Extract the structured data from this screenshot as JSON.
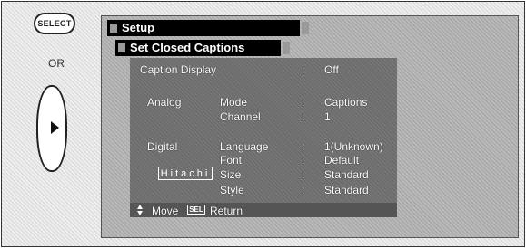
{
  "remote": {
    "select_label": "SELECT",
    "or_label": "OR"
  },
  "menu": {
    "tab_setup": "Setup",
    "tab_closed_captions": "Set Closed Captions",
    "caption_display": {
      "label": "Caption Display",
      "sep": ":",
      "value": "Off"
    },
    "analog": {
      "heading": "Analog",
      "mode": {
        "label": "Mode",
        "sep": ":",
        "value": "Captions"
      },
      "channel": {
        "label": "Channel",
        "sep": ":",
        "value": "1"
      }
    },
    "digital": {
      "heading": "Digital",
      "language": {
        "label": "Language",
        "sep": ":",
        "value": "1(Unknown)"
      },
      "font": {
        "label": "Font",
        "sep": ":",
        "value": "Default"
      },
      "size": {
        "label": "Size",
        "sep": ":",
        "value": "Standard"
      },
      "style": {
        "label": "Style",
        "sep": ":",
        "value": "Standard"
      }
    },
    "brand": "Hitachi",
    "footer": {
      "move_label": "Move",
      "sel_key": "SEL",
      "return_label": "Return"
    }
  }
}
